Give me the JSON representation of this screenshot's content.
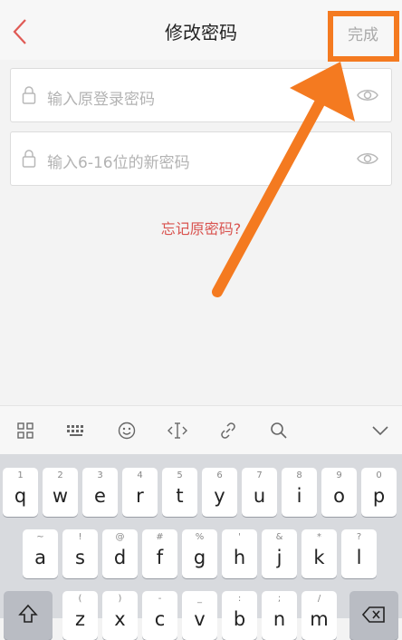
{
  "header": {
    "title": "修改密码",
    "done_label": "完成"
  },
  "form": {
    "old_password_placeholder": "输入原登录密码",
    "new_password_placeholder": "输入6-16位的新密码",
    "forgot_link": "忘记原密码?"
  },
  "colors": {
    "accent": "#d9534f",
    "annotation": "#f47a20"
  },
  "keyboard": {
    "toolbar_icons": [
      "grid-icon",
      "keyboard-icon",
      "emoji-icon",
      "cursor-icon",
      "link-icon",
      "search-icon",
      "chevron-down-icon"
    ],
    "row1": [
      {
        "hint": "1",
        "key": "q"
      },
      {
        "hint": "2",
        "key": "w"
      },
      {
        "hint": "3",
        "key": "e"
      },
      {
        "hint": "4",
        "key": "r"
      },
      {
        "hint": "5",
        "key": "t"
      },
      {
        "hint": "6",
        "key": "y"
      },
      {
        "hint": "7",
        "key": "u"
      },
      {
        "hint": "8",
        "key": "i"
      },
      {
        "hint": "9",
        "key": "o"
      },
      {
        "hint": "0",
        "key": "p"
      }
    ],
    "row2": [
      {
        "hint": "~",
        "key": "a"
      },
      {
        "hint": "!",
        "key": "s"
      },
      {
        "hint": "@",
        "key": "d"
      },
      {
        "hint": "#",
        "key": "f"
      },
      {
        "hint": "%",
        "key": "g"
      },
      {
        "hint": "'",
        "key": "h"
      },
      {
        "hint": "&",
        "key": "j"
      },
      {
        "hint": "*",
        "key": "k"
      },
      {
        "hint": "?",
        "key": "l"
      }
    ],
    "row3": [
      {
        "hint": "(",
        "key": "z"
      },
      {
        "hint": ")",
        "key": "x"
      },
      {
        "hint": "-",
        "key": "c"
      },
      {
        "hint": "_",
        "key": "v"
      },
      {
        "hint": ":",
        "key": "b"
      },
      {
        "hint": ";",
        "key": "n"
      },
      {
        "hint": "/",
        "key": "m"
      }
    ]
  }
}
